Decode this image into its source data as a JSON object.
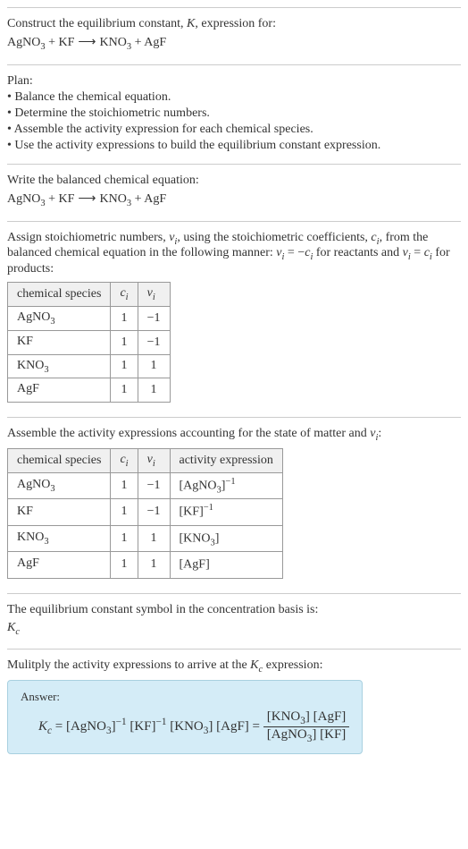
{
  "intro": {
    "prompt": "Construct the equilibrium constant, ",
    "k": "K",
    "prompt2": ", expression for:"
  },
  "reaction": {
    "r1": "AgNO",
    "r1sub": "3",
    "plus1": " + ",
    "r2": "KF",
    "arrow": "⟶",
    "p1": "KNO",
    "p1sub": "3",
    "plus2": " + ",
    "p2": "AgF"
  },
  "plan": {
    "heading": "Plan:",
    "items": [
      "• Balance the chemical equation.",
      "• Determine the stoichiometric numbers.",
      "• Assemble the activity expression for each chemical species.",
      "• Use the activity expressions to build the equilibrium constant expression."
    ]
  },
  "balanced": {
    "heading": "Write the balanced chemical equation:"
  },
  "stoich": {
    "text1": "Assign stoichiometric numbers, ",
    "nu": "ν",
    "i": "i",
    "text2": ", using the stoichiometric coefficients, ",
    "c": "c",
    "text3": ", from the balanced chemical equation in the following manner: ",
    "eq1a": " = −",
    "text4": " for reactants and ",
    "eq2a": " = ",
    "text5": " for products:",
    "headers": {
      "species": "chemical species",
      "ci": "c",
      "nui": "ν"
    },
    "rows": [
      {
        "species_a": "AgNO",
        "species_sub": "3",
        "ci": "1",
        "nui": "−1"
      },
      {
        "species_a": "KF",
        "species_sub": "",
        "ci": "1",
        "nui": "−1"
      },
      {
        "species_a": "KNO",
        "species_sub": "3",
        "ci": "1",
        "nui": "1"
      },
      {
        "species_a": "AgF",
        "species_sub": "",
        "ci": "1",
        "nui": "1"
      }
    ]
  },
  "activity": {
    "heading": "Assemble the activity expressions accounting for the state of matter and ",
    "heading2": ":",
    "headers": {
      "species": "chemical species",
      "ci": "c",
      "nui": "ν",
      "act": "activity expression"
    },
    "rows": [
      {
        "species_a": "AgNO",
        "species_sub": "3",
        "ci": "1",
        "nui": "−1",
        "act_a": "[AgNO",
        "act_sub": "3",
        "act_b": "]",
        "act_exp": "−1"
      },
      {
        "species_a": "KF",
        "species_sub": "",
        "ci": "1",
        "nui": "−1",
        "act_a": "[KF",
        "act_sub": "",
        "act_b": "]",
        "act_exp": "−1"
      },
      {
        "species_a": "KNO",
        "species_sub": "3",
        "ci": "1",
        "nui": "1",
        "act_a": "[KNO",
        "act_sub": "3",
        "act_b": "]",
        "act_exp": ""
      },
      {
        "species_a": "AgF",
        "species_sub": "",
        "ci": "1",
        "nui": "1",
        "act_a": "[AgF",
        "act_sub": "",
        "act_b": "]",
        "act_exp": ""
      }
    ]
  },
  "kc_symbol": {
    "text": "The equilibrium constant symbol in the concentration basis is:",
    "symbol": "K",
    "sub": "c"
  },
  "multiply": {
    "text1": "Mulitply the activity expressions to arrive at the ",
    "k": "K",
    "c": "c",
    "text2": " expression:"
  },
  "answer": {
    "label": "Answer:",
    "lhs_k": "K",
    "lhs_c": "c",
    "eq": " = ",
    "t1": "[AgNO",
    "t1sub": "3",
    "t1b": "]",
    "exp_neg1": "−1",
    "t2": " [KF]",
    "t3": " [KNO",
    "t3sub": "3",
    "t3b": "]",
    "t4": " [AgF]",
    "eq2": " = ",
    "num1": "[KNO",
    "num1sub": "3",
    "num2": "] [AgF]",
    "den1": "[AgNO",
    "den1sub": "3",
    "den2": "] [KF]"
  }
}
